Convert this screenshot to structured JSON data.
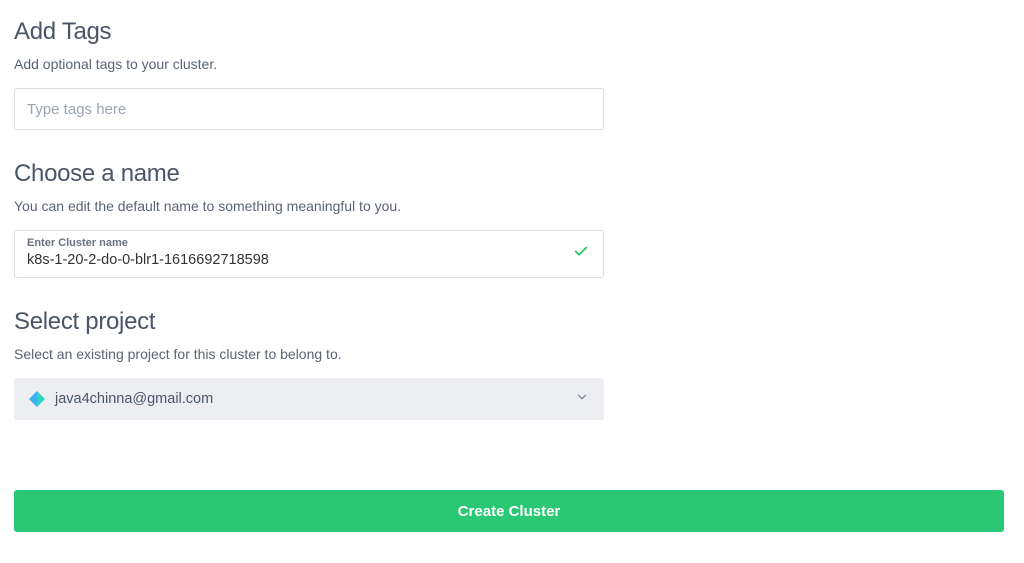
{
  "addTags": {
    "title": "Add Tags",
    "desc": "Add optional tags to your cluster.",
    "placeholder": "Type tags here"
  },
  "chooseName": {
    "title": "Choose a name",
    "desc": "You can edit the default name to something meaningful to you.",
    "fieldLabel": "Enter Cluster name",
    "value": "k8s-1-20-2-do-0-blr1-1616692718598"
  },
  "selectProject": {
    "title": "Select project",
    "desc": "Select an existing project for this cluster to belong to.",
    "selected": "java4chinna@gmail.com"
  },
  "createButton": "Create Cluster",
  "colors": {
    "accent": "#2ac874",
    "success": "#22c55e"
  }
}
